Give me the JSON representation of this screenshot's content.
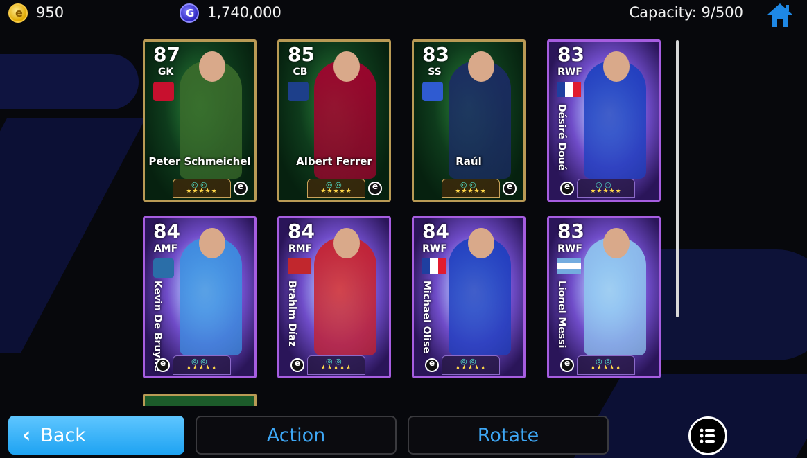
{
  "top": {
    "coins": "950",
    "gp": "1,740,000",
    "capacity": "Capacity: 9/500"
  },
  "cards": [
    {
      "rating": "87",
      "position": "GK",
      "name": "Peter Schmeichel",
      "style": "gold",
      "kit": "#3a6b2b",
      "crest_color": "#c8102e"
    },
    {
      "rating": "85",
      "position": "CB",
      "name": "Albert Ferrer",
      "style": "gold",
      "kit": "#a5002e",
      "crest_color": "#1d3f8a"
    },
    {
      "rating": "83",
      "position": "SS",
      "name": "Raúl",
      "style": "gold",
      "kit": "#1b2a66",
      "crest_color": "#2f5bd1"
    },
    {
      "rating": "83",
      "position": "RWF",
      "name": "Désiré Doué",
      "style": "purple",
      "kit": "#1c3fbf",
      "flag": [
        "#1f3fa0",
        "#ffffff",
        "#e11b2f"
      ]
    },
    {
      "rating": "84",
      "position": "AMF",
      "name": "Kevin De Bruyne",
      "style": "purple",
      "kit": "#3a8fe0",
      "crest_color": "#2a6ea8"
    },
    {
      "rating": "84",
      "position": "RMF",
      "name": "Brahim Díaz",
      "style": "purple",
      "kit": "#c9202a",
      "flag": [
        "#c1272d",
        "#c1272d",
        "#c1272d"
      ]
    },
    {
      "rating": "84",
      "position": "RWF",
      "name": "Michael Olise",
      "style": "purple",
      "kit": "#1c3fbf",
      "flag": [
        "#1f3fa0",
        "#ffffff",
        "#e11b2f"
      ]
    },
    {
      "rating": "83",
      "position": "RWF",
      "name": "Lionel Messi",
      "style": "purple",
      "kit": "#8ec5ef",
      "flag_h": [
        "#74acdf",
        "#ffffff",
        "#74acdf"
      ]
    }
  ],
  "card_stars": "★★★★★",
  "card_skill_icons": "◎ ◎",
  "buttons": {
    "back": "Back",
    "action": "Action",
    "rotate": "Rotate"
  },
  "icons": {
    "coin": "efootball-coin-icon",
    "gp": "gp-icon",
    "home": "home-icon",
    "menu": "list-menu-icon",
    "back": "chevron-left-icon"
  },
  "colors": {
    "accent_blue": "#3ea7f5",
    "back_button": "#1ea3f2",
    "gold_border": "#b99a55",
    "purple_border": "#a65de0"
  }
}
